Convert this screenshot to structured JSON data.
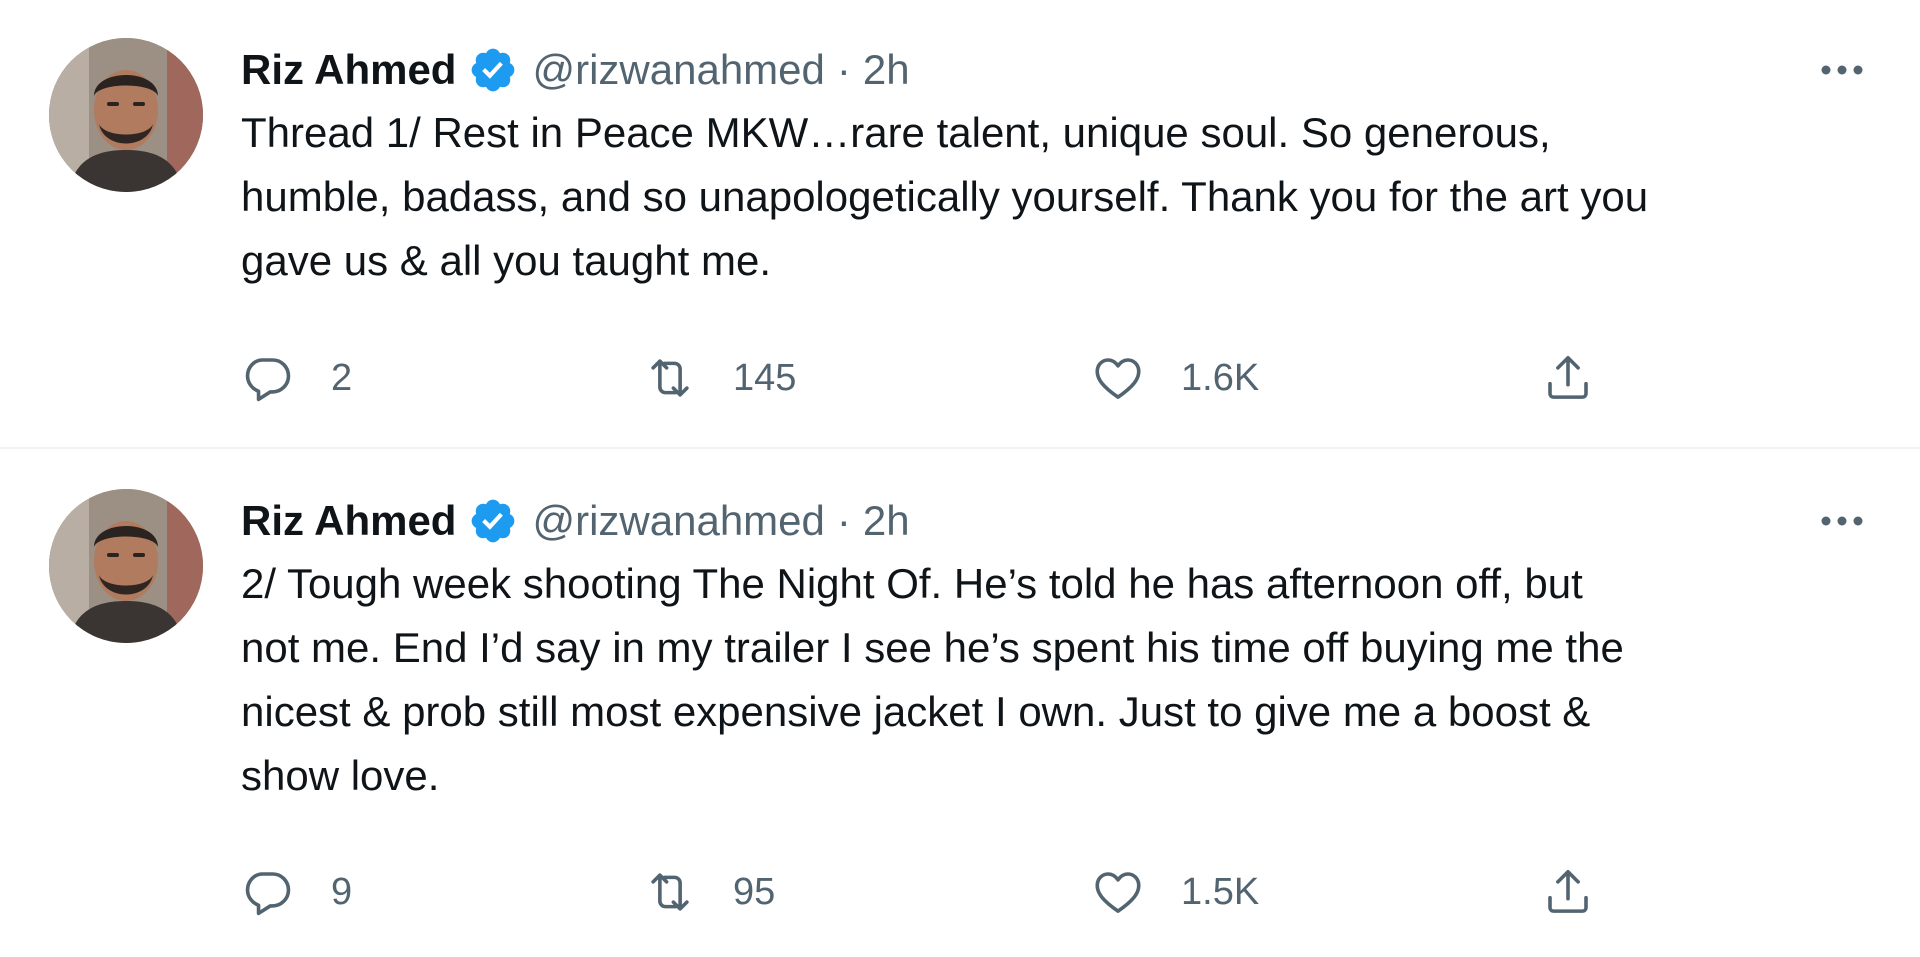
{
  "tweets": [
    {
      "author_name": "Riz Ahmed",
      "handle": "@rizwanahmed",
      "separator": "·",
      "time": "2h",
      "text": "Thread 1/ Rest in Peace MKW…rare talent, unique soul. So generous,\nhumble, badass, and so unapologetically yourself. Thank you for the art you\ngave us & all you taught me.",
      "replies": "2",
      "retweets": "145",
      "likes": "1.6K"
    },
    {
      "author_name": "Riz Ahmed",
      "handle": "@rizwanahmed",
      "separator": "·",
      "time": "2h",
      "text": "2/ Tough week shooting The Night Of. He’s told he has afternoon off, but\nnot me. End I’d say in my trailer I see he’s spent his time off buying me the\nnicest & prob still most expensive jacket I own. Just to give me a boost &\nshow love.",
      "replies": "9",
      "retweets": "95",
      "likes": "1.5K"
    }
  ],
  "icons": {
    "verified": "verified-badge-icon",
    "more": "more-options-icon",
    "reply": "reply-icon",
    "retweet": "retweet-icon",
    "like": "heart-icon",
    "share": "share-icon"
  },
  "colors": {
    "verified_blue": "#1d9bf0",
    "secondary_text": "#536471",
    "primary_text": "#0f1419",
    "divider": "#eff3f4"
  }
}
